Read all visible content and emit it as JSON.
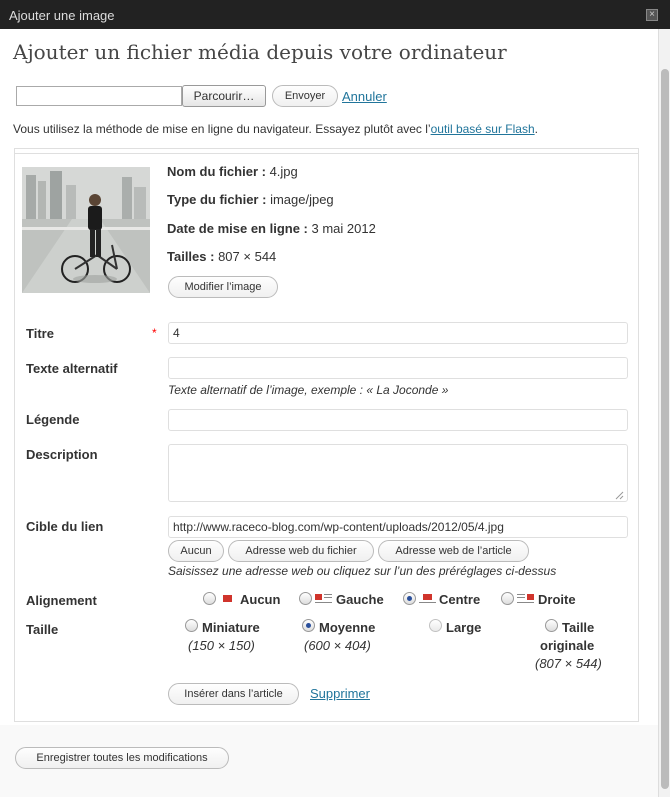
{
  "window": {
    "title": "Ajouter une image"
  },
  "heading": "Ajouter un fichier média depuis votre ordinateur",
  "upload": {
    "browse_label": "Parcourir…",
    "send_label": "Envoyer",
    "cancel_label": "Annuler",
    "notice_prefix": "Vous utilisez la méthode de mise en ligne du navigateur. Essayez plutôt avec l’",
    "notice_link": "outil basé sur Flash",
    "notice_suffix": "."
  },
  "file": {
    "name_label": "Nom du fichier :",
    "name_value": "4.jpg",
    "type_label": "Type du fichier :",
    "type_value": "image/jpeg",
    "date_label": "Date de mise en ligne :",
    "date_value": "3 mai 2012",
    "size_label": "Tailles :",
    "size_value": "807 × 544",
    "edit_label": "Modifier l’image"
  },
  "form": {
    "title_label": "Titre",
    "required_mark": "*",
    "title_value": "4",
    "alt_label": "Texte alternatif",
    "alt_value": "",
    "alt_hint": "Texte alternatif de l’image, exemple : « La Joconde »",
    "caption_label": "Légende",
    "caption_value": "",
    "description_label": "Description",
    "description_value": "",
    "link_label": "Cible du lien",
    "link_value": "http://www.raceco-blog.com/wp-content/uploads/2012/05/4.jpg",
    "link_none": "Aucun",
    "link_file": "Adresse web du fichier",
    "link_post": "Adresse web de l’article",
    "link_hint": "Saisissez une adresse web ou cliquez sur l’un des préréglages ci-dessus",
    "align_label": "Alignement",
    "align_options": [
      "Aucun",
      "Gauche",
      "Centre",
      "Droite"
    ],
    "align_selected": "Centre",
    "size_label": "Taille",
    "sizes": [
      {
        "name": "Miniature",
        "dims": "(150 × 150)"
      },
      {
        "name": "Moyenne",
        "dims": "(600 × 404)"
      },
      {
        "name": "Large",
        "dims": ""
      },
      {
        "name_line1": "Taille",
        "name_line2": "originale",
        "dims": "(807 × 544)"
      }
    ],
    "size_selected": "Moyenne",
    "insert_label": "Insérer dans l’article",
    "delete_label": "Supprimer"
  },
  "footer": {
    "save_all_label": "Enregistrer toutes les modifications"
  },
  "colors": {
    "titlebar": "#222222",
    "link": "#21759b",
    "required": "#ff0000",
    "radio_dot": "#2a4f9b"
  }
}
